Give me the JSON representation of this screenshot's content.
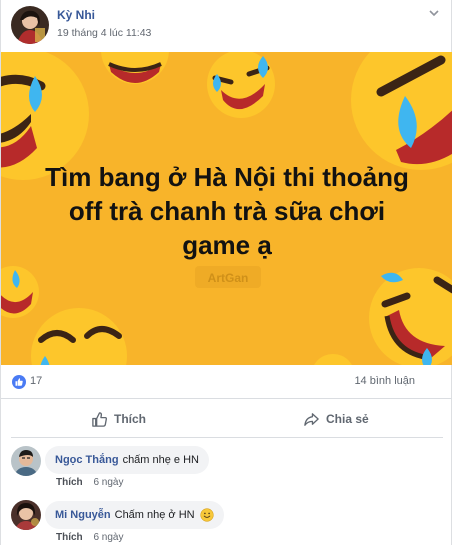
{
  "post": {
    "author": "Kỳ Nhi",
    "timestamp": "19 tháng 4 lúc 11:43",
    "image_text_lines": [
      "Tìm bang ở Hà Nội thi thoảng",
      "off trà chanh trà sữa chơi",
      "game ạ"
    ],
    "watermark": "ArtGan"
  },
  "stats": {
    "likes": "17",
    "comments": "14 bình luận"
  },
  "actions": {
    "like_label": "Thích",
    "share_label": "Chia sẻ"
  },
  "comments": [
    {
      "name": "Ngọc Thắng",
      "text": "chấm nhẹ e HN",
      "like_label": "Thích",
      "time": "6 ngày"
    },
    {
      "name": "Mi Nguyễn",
      "text": "Chấm nhẹ ở HN",
      "like_label": "Thích",
      "time": "6 ngày"
    }
  ],
  "colors": {
    "link": "#385898",
    "banner": "#f8b42a",
    "like_blue": "#4a7bf4"
  }
}
